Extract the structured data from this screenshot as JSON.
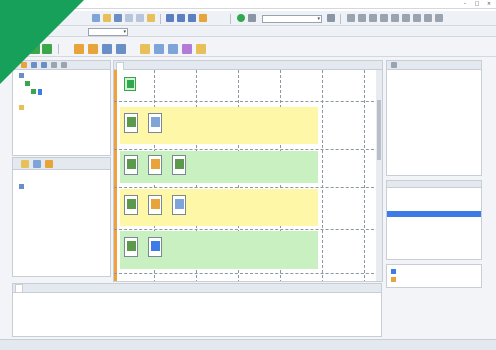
{
  "window": {
    "title": ""
  },
  "menu": {
    "items": [
      "",
      "",
      "",
      "",
      "",
      "",
      "",
      ""
    ]
  },
  "toolbar": {
    "zoom_value": "",
    "input_placeholder": ""
  },
  "left_tree": {
    "items": [
      {
        "label": "",
        "selected": false
      },
      {
        "label": "",
        "selected": false
      },
      {
        "label": "",
        "selected": true
      },
      {
        "label": "",
        "selected": false
      }
    ]
  },
  "left_lower": {
    "items": [
      {
        "label": "",
        "value": ""
      },
      {
        "label": "",
        "value": ""
      }
    ]
  },
  "canvas": {
    "tabs": [
      "",
      "",
      "",
      ""
    ],
    "lanes": [
      {
        "label": "",
        "color": "#fff7a8"
      },
      {
        "label": "",
        "color": "#c8f0c0"
      },
      {
        "label": "",
        "color": "#fff7a8"
      },
      {
        "label": "",
        "color": "#c8f0c0"
      }
    ]
  },
  "properties": {
    "rows": [
      {
        "key": "",
        "value": ""
      },
      {
        "key": "",
        "value": ""
      },
      {
        "key": "",
        "value": ""
      },
      {
        "key": "",
        "value": ""
      },
      {
        "key": "",
        "value": ""
      },
      {
        "key": "",
        "value": ""
      },
      {
        "key": "",
        "value": ""
      },
      {
        "key": "",
        "value": ""
      }
    ]
  },
  "variables": {
    "columns": [
      "",
      "",
      ""
    ],
    "rows": [
      {
        "name": "",
        "type": "",
        "value": "",
        "selected": true
      },
      {
        "name": "",
        "type": "",
        "value": "",
        "selected": false
      },
      {
        "name": "",
        "type": "",
        "value": "",
        "selected": false
      },
      {
        "name": "",
        "type": "",
        "value": "",
        "selected": false
      }
    ]
  },
  "bottom_right": {
    "items": [
      "",
      ""
    ]
  },
  "output": {
    "tab": "",
    "lines": [
      "",
      "",
      "",
      ""
    ]
  },
  "status": {
    "left": "",
    "middle": ""
  },
  "colors": {
    "accent": "#3d7be6",
    "corner": "#16a05a",
    "lane_yellow": "#fff7a8",
    "lane_green": "#c8f0c0",
    "orange_marker": "#f0a03c"
  },
  "icons": [
    "app-icon",
    "folder-icon",
    "save-icon",
    "run-icon",
    "stop-icon",
    "node-icon",
    "cube-icon"
  ]
}
